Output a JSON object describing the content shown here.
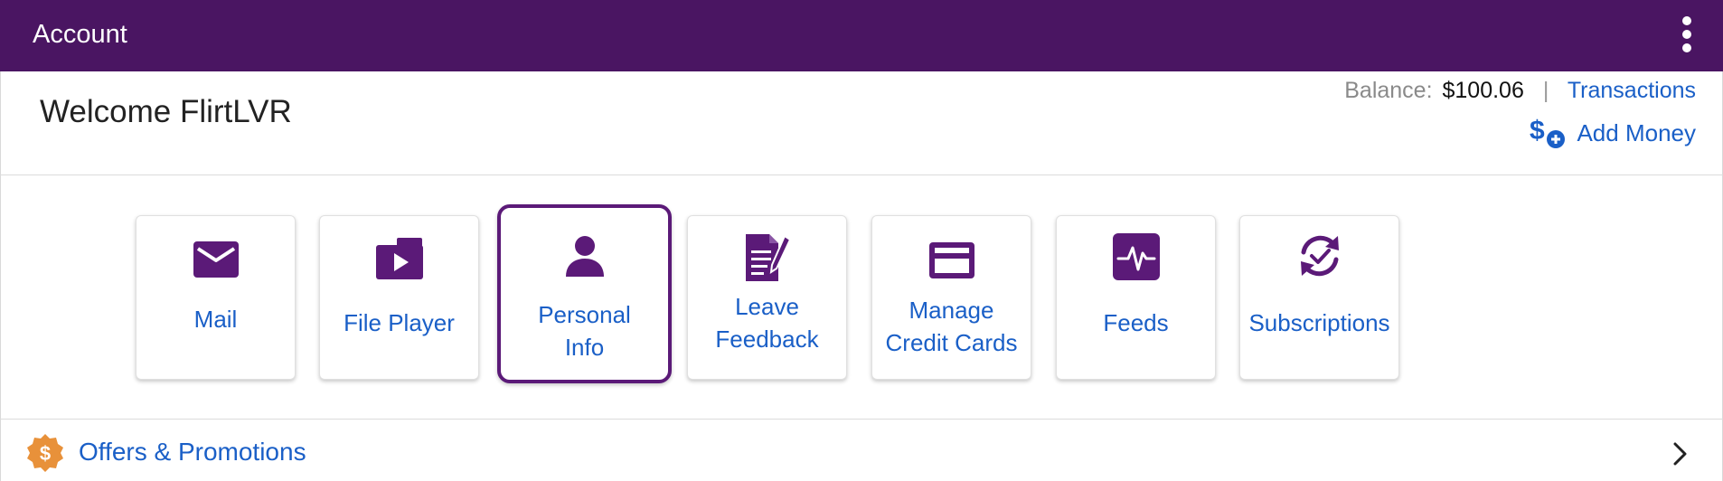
{
  "header": {
    "title": "Account",
    "menu_icon": "more-vertical-icon"
  },
  "welcome": "Welcome FlirtLVR",
  "balance": {
    "label": "Balance:",
    "value": "$100.06",
    "separator": "|",
    "transactions": "Transactions",
    "add_money": "Add Money",
    "add_money_icon": "add-money-icon"
  },
  "tiles": [
    {
      "line1": "Mail",
      "line2": "",
      "icon": "mail-icon"
    },
    {
      "line1": "File Player",
      "line2": "",
      "icon": "video-folder-icon"
    },
    {
      "line1": "Personal",
      "line2": "Info",
      "icon": "person-icon",
      "selected": true
    },
    {
      "line1": "Leave",
      "line2": "Feedback",
      "icon": "feedback-document-icon"
    },
    {
      "line1": "Manage",
      "line2": "Credit Cards",
      "icon": "credit-card-icon"
    },
    {
      "line1": "Feeds",
      "line2": "",
      "icon": "activity-pulse-icon"
    },
    {
      "line1": "Subscriptions",
      "line2": "",
      "icon": "subscription-sync-icon"
    }
  ],
  "offers": {
    "label": "Offers & Promotions",
    "icon": "dollar-badge-icon",
    "chevron": "chevron-right-icon"
  },
  "colors": {
    "header_bg": "#4a1562",
    "accent_purple": "#5b1a78",
    "link_blue": "#1a5fc7",
    "badge_orange": "#e8913a"
  }
}
